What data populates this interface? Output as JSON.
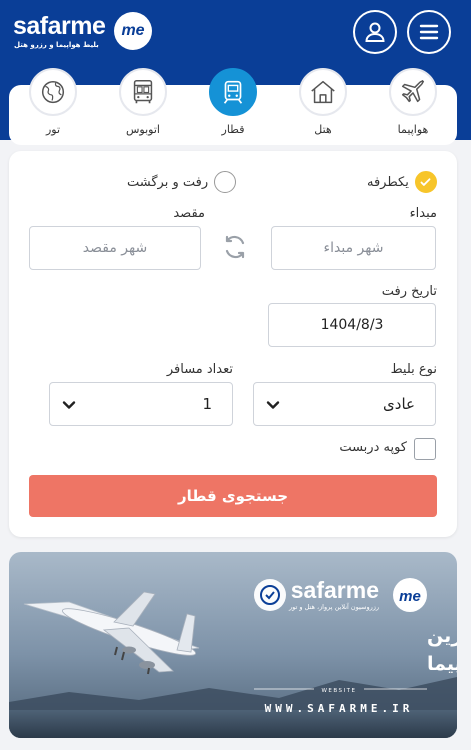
{
  "header": {
    "brand": "safarme",
    "tagline": "بلیط هواپیما و رزرو هتل",
    "badge": "me"
  },
  "tabs": [
    {
      "label": "هواپیما",
      "icon": "airplane-icon",
      "active": false
    },
    {
      "label": "هتل",
      "icon": "house-icon",
      "active": false
    },
    {
      "label": "قطار",
      "icon": "train-icon",
      "active": true
    },
    {
      "label": "اتوبوس",
      "icon": "bus-icon",
      "active": false
    },
    {
      "label": "تور",
      "icon": "globe-icon",
      "active": false
    }
  ],
  "form": {
    "trip_oneway": "یکطرفه",
    "trip_round": "رفت و برگشت",
    "origin_label": "مبداء",
    "origin_placeholder": "شهر مبداء",
    "destination_label": "مقصد",
    "destination_placeholder": "شهر مقصد",
    "date_label": "تاریخ رفت",
    "date_value": "1404/8/3",
    "ticket_type_label": "نوع بلیط",
    "ticket_type_value": "عادی",
    "passengers_label": "تعداد مسافر",
    "passengers_value": "1",
    "coupe_label": "کوپه دربست",
    "search_button": "جستجوی قطار"
  },
  "banner": {
    "brand": "safarme",
    "brand_sub": "رزروسیون آنلاین پرواز، هتل و تور",
    "headline_1": "گارانتی ارزان ترین",
    "headline_2": "نرخ بلیط هواپیما",
    "website_label": "WEBSITE",
    "website": "WWW.SAFARME.IR"
  },
  "colors": {
    "header_bg": "#0a3e97",
    "active_tab": "#1592d6",
    "check": "#f7c52a",
    "search_btn": "#ee7565"
  }
}
